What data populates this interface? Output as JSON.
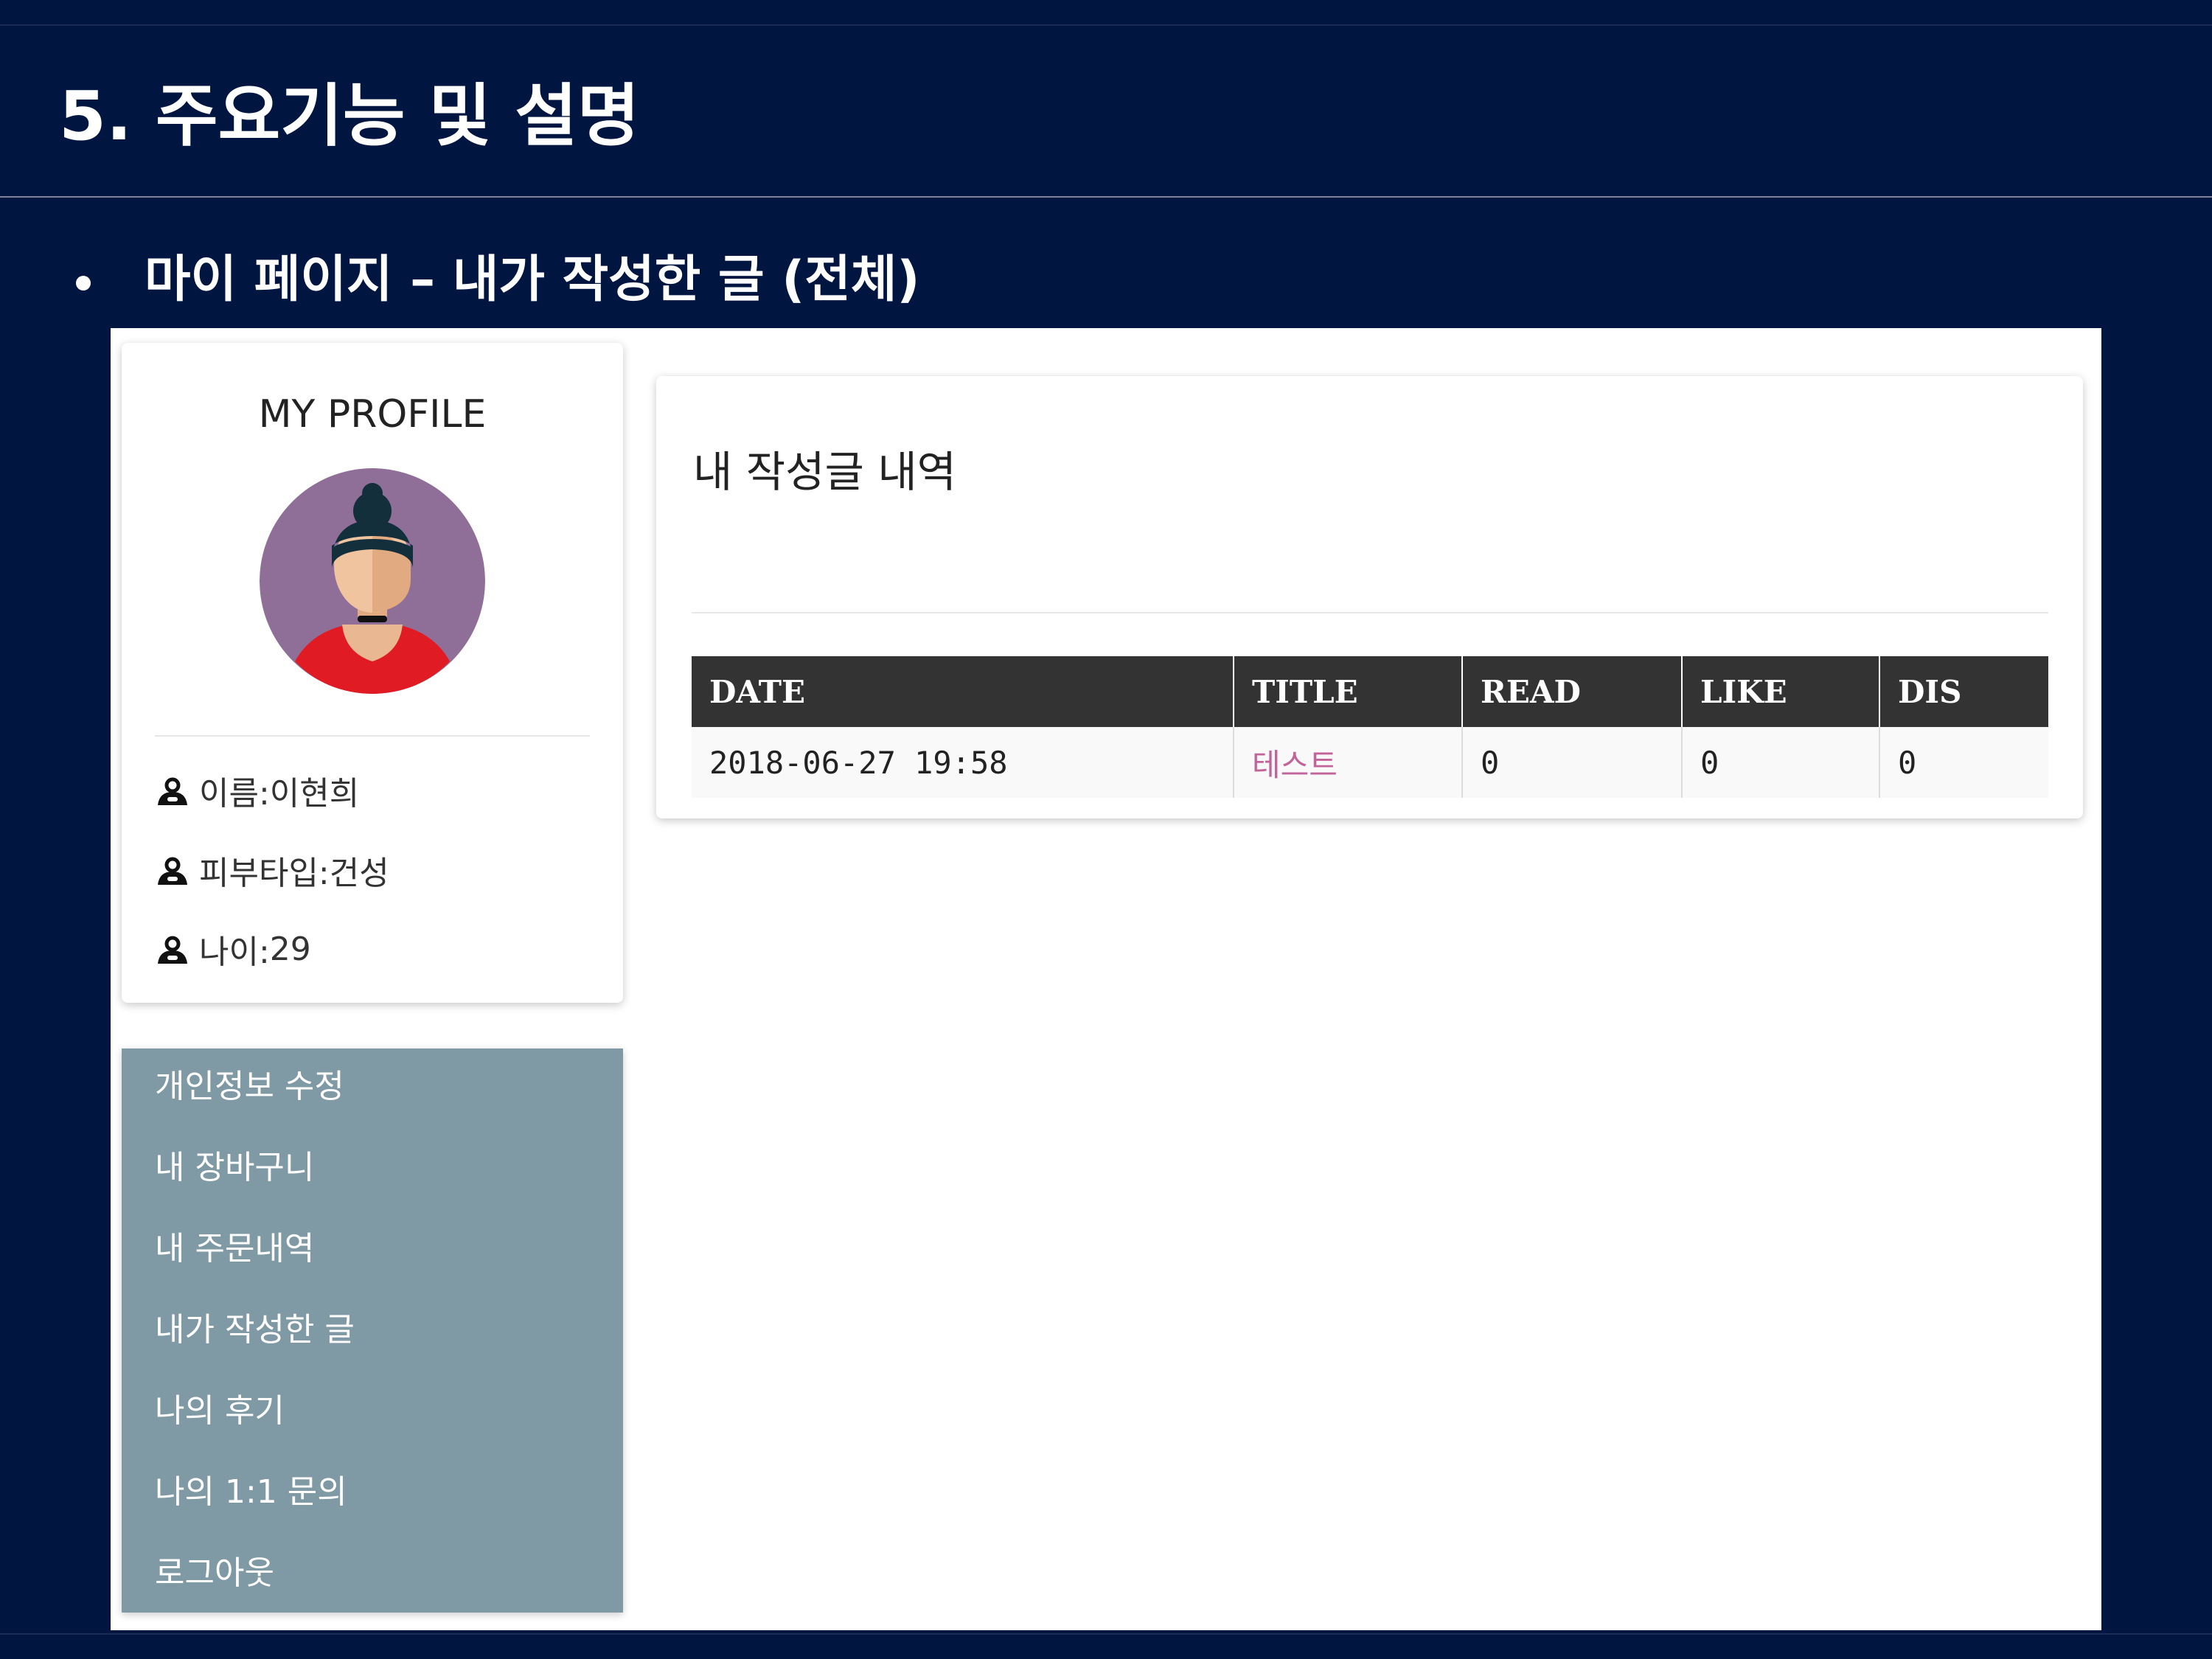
{
  "slide": {
    "title": "5. 주요기능 및 설명",
    "subtitle": "마이 페이지 – 내가 작성한 글 (전체)"
  },
  "profile": {
    "heading": "MY PROFILE",
    "avatar_icon": "woman-avatar-icon",
    "fields": [
      {
        "icon": "user-icon",
        "label": "이름",
        "value": "이현희"
      },
      {
        "icon": "user-icon",
        "label": "피부타입",
        "value": "건성"
      },
      {
        "icon": "user-icon",
        "label": "나이",
        "value": "29"
      }
    ]
  },
  "menu": {
    "background_color": "#7f99a5",
    "items": [
      "개인정보 수정",
      "내 장바구니",
      "내 주문내역",
      "내가 작성한 글",
      "나의 후기",
      "나의 1:1 문의",
      "로그아웃"
    ]
  },
  "posts": {
    "heading": "내 작성글 내역",
    "columns": [
      "DATE",
      "TITLE",
      "READ",
      "LIKE",
      "DIS"
    ],
    "rows": [
      {
        "date": "2018-06-27 19:58",
        "title": "테스트",
        "read": "0",
        "like": "0",
        "dis": "0"
      }
    ],
    "title_link_color": "#c2639a"
  },
  "colors": {
    "slide_background": "#001540",
    "table_header": "#333333"
  }
}
